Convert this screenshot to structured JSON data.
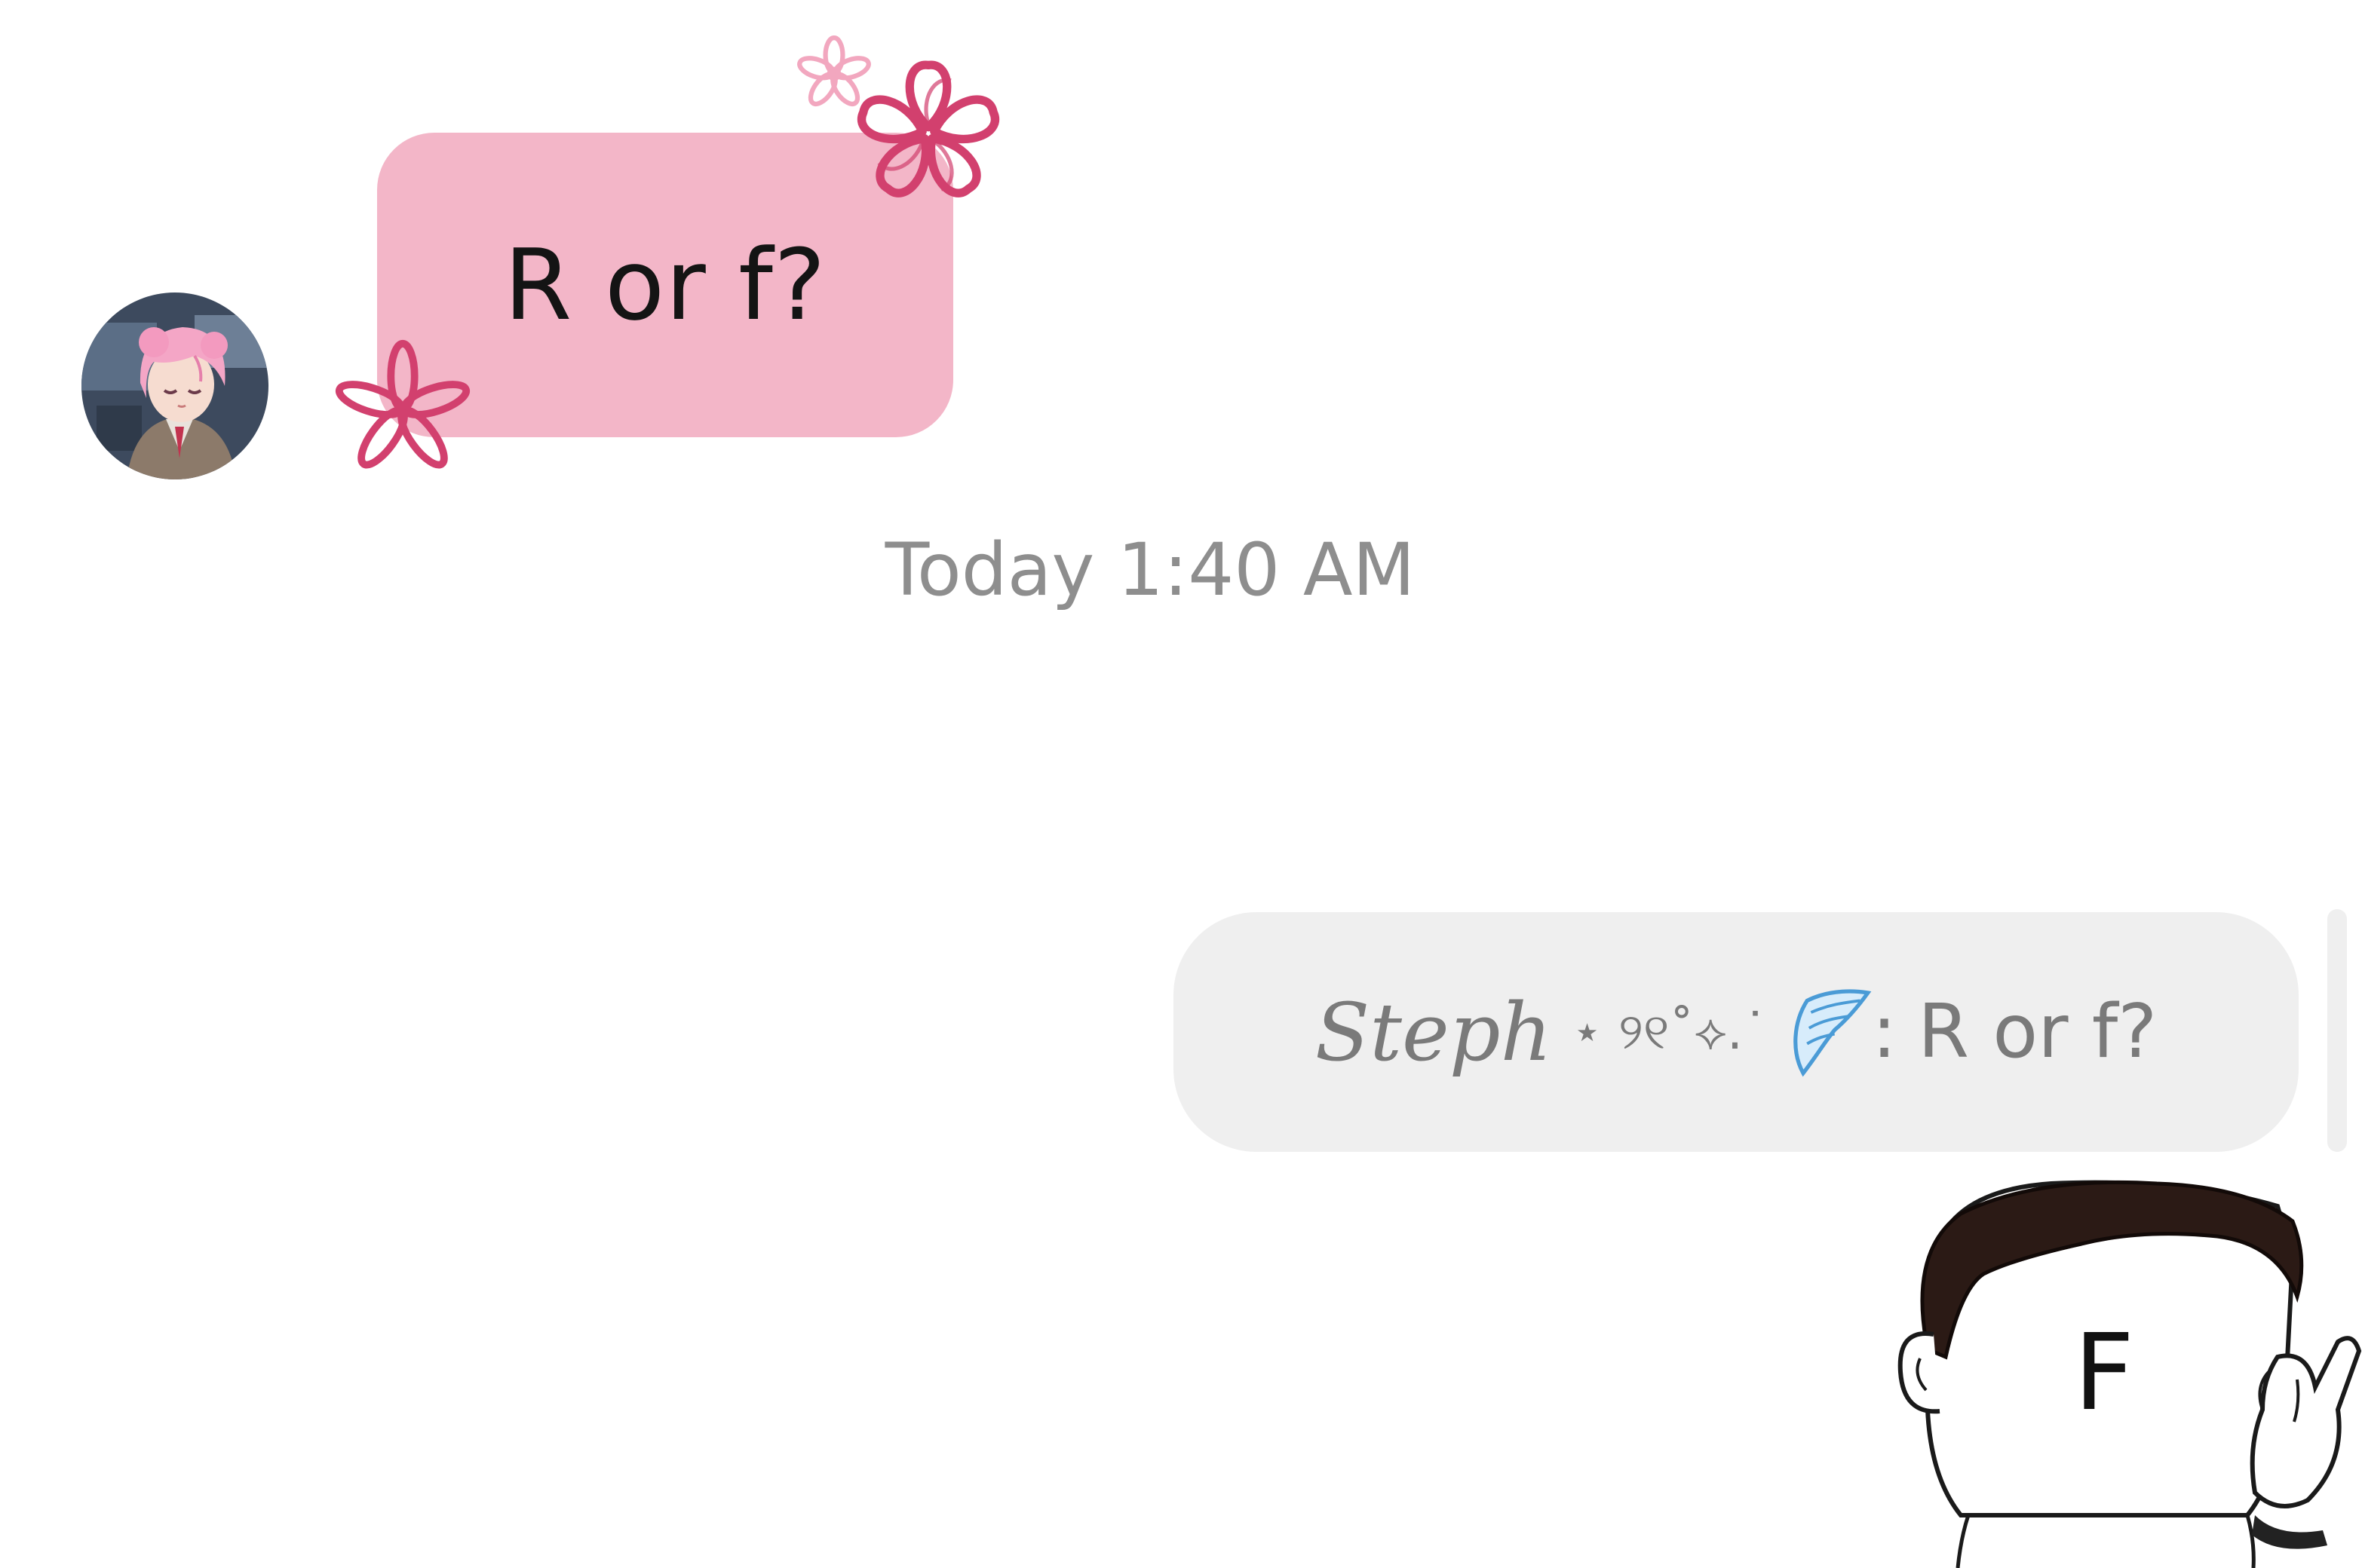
{
  "incoming_message": {
    "text": "R or f?",
    "bubble_color": "#f3b6c8",
    "avatar": {
      "icon": "anime-girl-avatar-icon",
      "hair_color": "#f4a6c6"
    },
    "stickers": [
      "flower-sticker-icon",
      "flower-sticker-icon",
      "flower-sticker-icon"
    ]
  },
  "timestamp": "Today 1:40 AM",
  "reply_preview": {
    "author": "Steph",
    "author_decoration": "⋆ ୨୧˚⟡.˙",
    "decoration_icon": "angel-wing-icon",
    "separator": ":",
    "text": "R or f?",
    "bubble_color": "#efefef"
  },
  "sticker_reply": {
    "icon": "facepalm-meme-sticker-icon",
    "text": "F"
  },
  "colors": {
    "flower_dark": "#d2406e",
    "flower_light": "#f2a7bf",
    "timestamp_text": "#8e8e8e"
  }
}
